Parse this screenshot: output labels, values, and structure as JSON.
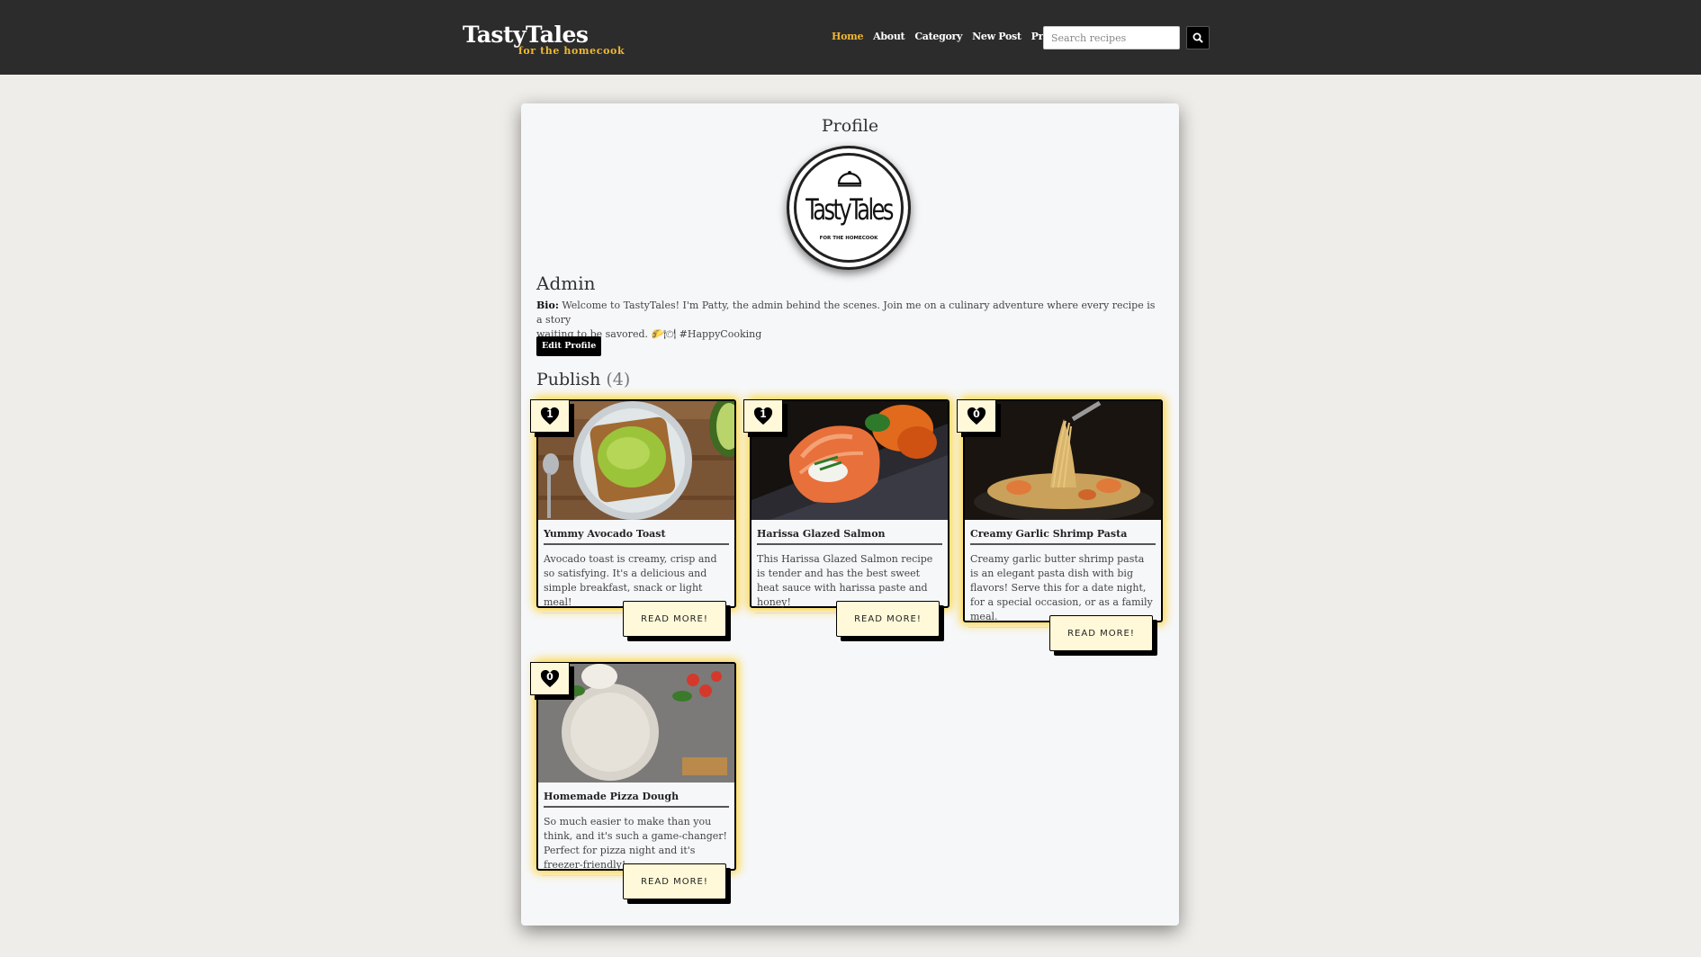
{
  "navbar": {
    "brand_name": "TastyTales",
    "brand_tagline": "for the homecook",
    "links": [
      "Home",
      "About",
      "Category",
      "New Post",
      "Profile"
    ],
    "search_placeholder": "Search recipes"
  },
  "page_title": "Profile",
  "logo": {
    "text": "TastyTales",
    "subtext": "FOR THE HOMECOOK"
  },
  "user": {
    "name": "Admin",
    "bio_label": "Bio:",
    "bio_line1": "Welcome to TastyTales! I'm Patty, the admin behind the scenes. Join me on a culinary adventure where every recipe is a story",
    "bio_line2": "waiting to be savored. 🌮🍽 #HappyCooking",
    "edit_button": "Edit Profile"
  },
  "publish": {
    "label": "Publish",
    "count": "(4)"
  },
  "read_more_label": "READ MORE!",
  "recipes": [
    {
      "title": "Yummy Avocado Toast",
      "description": "Avocado toast is creamy, crisp and so satisfying. It's a delicious and simple breakfast, snack or light meal!",
      "likes": "1"
    },
    {
      "title": "Harissa Glazed Salmon",
      "description": "This Harissa Glazed Salmon recipe is tender and has the best sweet heat sauce with harissa paste and honey!",
      "likes": "1"
    },
    {
      "title": "Creamy Garlic Shrimp Pasta",
      "description": "Creamy garlic butter shrimp pasta is an elegant pasta dish with big flavors! Serve this for a date night, for a special occasion, or as a family meal.",
      "likes": "0"
    },
    {
      "title": "Homemade Pizza Dough",
      "description": "So much easier to make than you think, and it's such a game-changer! Perfect for pizza night and it's freezer-friendly!",
      "likes": "0"
    }
  ],
  "colors": {
    "accent": "#f0b72f",
    "navbar": "#2c2c2c",
    "card_glow": "#ffd228",
    "badge_bg": "#fff9d9"
  }
}
